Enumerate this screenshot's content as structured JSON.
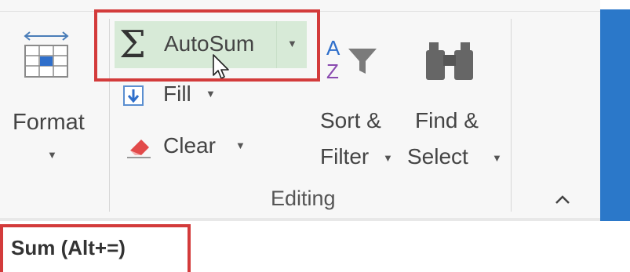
{
  "ribbon": {
    "format": {
      "label": "Format",
      "icon": "format-table-icon"
    },
    "autosum": {
      "label": "AutoSum",
      "icon": "sigma-icon"
    },
    "fill": {
      "label": "Fill",
      "icon": "fill-down-icon"
    },
    "clear": {
      "label": "Clear",
      "icon": "eraser-icon"
    },
    "sort_filter": {
      "line1": "Sort &",
      "line2": "Filter",
      "icon": "sort-filter-icon"
    },
    "find_select": {
      "line1": "Find &",
      "line2": "Select",
      "icon": "binoculars-icon"
    },
    "group_label": "Editing",
    "sigma_glyph": "Σ",
    "az_a": "A",
    "az_z": "Z"
  },
  "tooltip": {
    "text": "Sum (Alt+=)"
  },
  "colors": {
    "accent_green": "#d7ead7",
    "highlight_red": "#d33b3b",
    "app_blue": "#2b78c9"
  }
}
